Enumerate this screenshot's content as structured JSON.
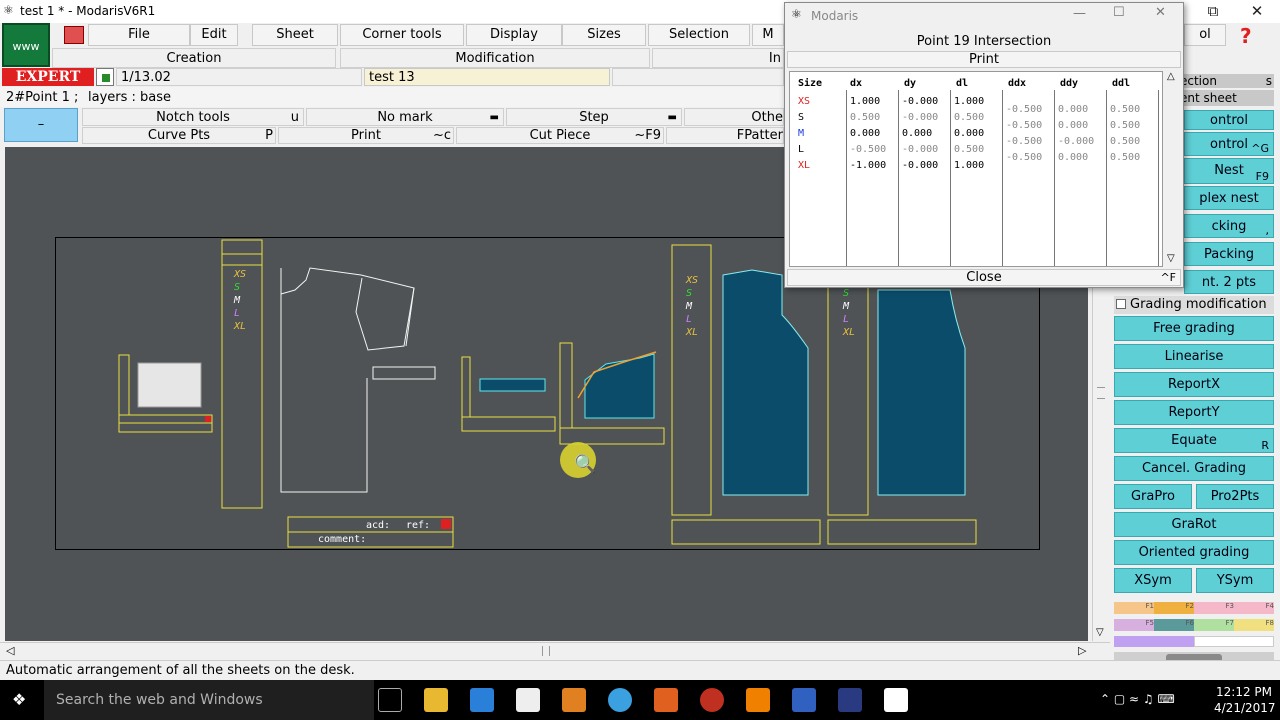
{
  "window": {
    "title": "test 1 * - ModarisV6R1"
  },
  "menu": {
    "www": "www",
    "items": [
      "File",
      "Edit",
      "Sheet",
      "Corner tools",
      "Display",
      "Sizes",
      "Selection",
      "M",
      "ol"
    ],
    "row2": [
      "Creation",
      "Modification",
      "In"
    ],
    "mode": "EXPERT",
    "version": "1/13.02",
    "model": "test 13"
  },
  "info": {
    "point": "2#Point 1 ;",
    "layers": "layers :  base"
  },
  "tools": {
    "row1": [
      {
        "label": "Notch tools",
        "key": "u"
      },
      {
        "label": "No mark",
        "key": ""
      },
      {
        "label": "Step",
        "key": ""
      },
      {
        "label": "Othe",
        "key": ""
      }
    ],
    "row2": [
      {
        "label": "Curve Pts",
        "key": "P"
      },
      {
        "label": "Print",
        "key": "~c"
      },
      {
        "label": "Cut Piece",
        "key": "~F9"
      },
      {
        "label": "FPatter",
        "key": ""
      }
    ],
    "dash": "–"
  },
  "piece_labels": {
    "sizes": [
      "XS",
      "S",
      "M",
      "L",
      "XL"
    ],
    "acd": "acd:",
    "ref": "ref:",
    "comment": "comment:"
  },
  "right_panel": {
    "top_items": [
      "ection",
      "ent sheet",
      "ontrol",
      "ontrol",
      "Nest",
      "plex nest",
      "cking",
      "Packing",
      "nt. 2 pts"
    ],
    "top_keys": [
      "s",
      "",
      "",
      "^G",
      "F9",
      "",
      ",",
      "",
      ""
    ],
    "grading_modification": "Grading modification",
    "buttons": [
      {
        "label": "Free grading",
        "key": ""
      },
      {
        "label": "Linearise",
        "key": ""
      },
      {
        "label": "ReportX",
        "key": ""
      },
      {
        "label": "ReportY",
        "key": ""
      },
      {
        "label": "Equate",
        "key": "R"
      },
      {
        "label": "Cancel. Grading",
        "key": ""
      }
    ],
    "pair1": [
      "GraPro",
      "Pro2Pts"
    ],
    "single2": "GraRot",
    "single3": "Oriented grading",
    "pair2": [
      "XSym",
      "YSym"
    ],
    "fkeys": [
      "F1",
      "F2",
      "F3",
      "F4",
      "F5",
      "F6",
      "F7",
      "F8"
    ]
  },
  "dialog": {
    "title": "Modaris",
    "header": "Point 19 Intersection",
    "print": "Print",
    "close": "Close",
    "close_key": "^F",
    "columns": [
      "Size",
      "dx",
      "dy",
      "dl",
      "ddx",
      "ddy",
      "ddl"
    ],
    "sizes": [
      "XS",
      "S",
      "M",
      "L",
      "XL"
    ],
    "size_colors": [
      "#e02020",
      "#000000",
      "#1a3cdc",
      "#000000",
      "#e02020"
    ],
    "dx": [
      "1.000",
      "0.500",
      "0.000",
      "-0.500",
      "-1.000"
    ],
    "dy": [
      "-0.000",
      "-0.000",
      "0.000",
      "-0.000",
      "-0.000"
    ],
    "dl": [
      "1.000",
      "0.500",
      "0.000",
      "0.500",
      "1.000"
    ],
    "ddx": [
      "-0.500",
      "-0.500",
      "-0.500",
      "-0.500"
    ],
    "ddy": [
      "0.000",
      "0.000",
      "-0.000",
      "0.000"
    ],
    "ddl": [
      "0.500",
      "0.500",
      "0.500",
      "0.500"
    ]
  },
  "status": {
    "message": "Automatic arrangement of all the sheets on the desk."
  },
  "taskbar": {
    "search": "Search the web and Windows",
    "time": "12:12 PM",
    "date": "4/21/2017"
  }
}
